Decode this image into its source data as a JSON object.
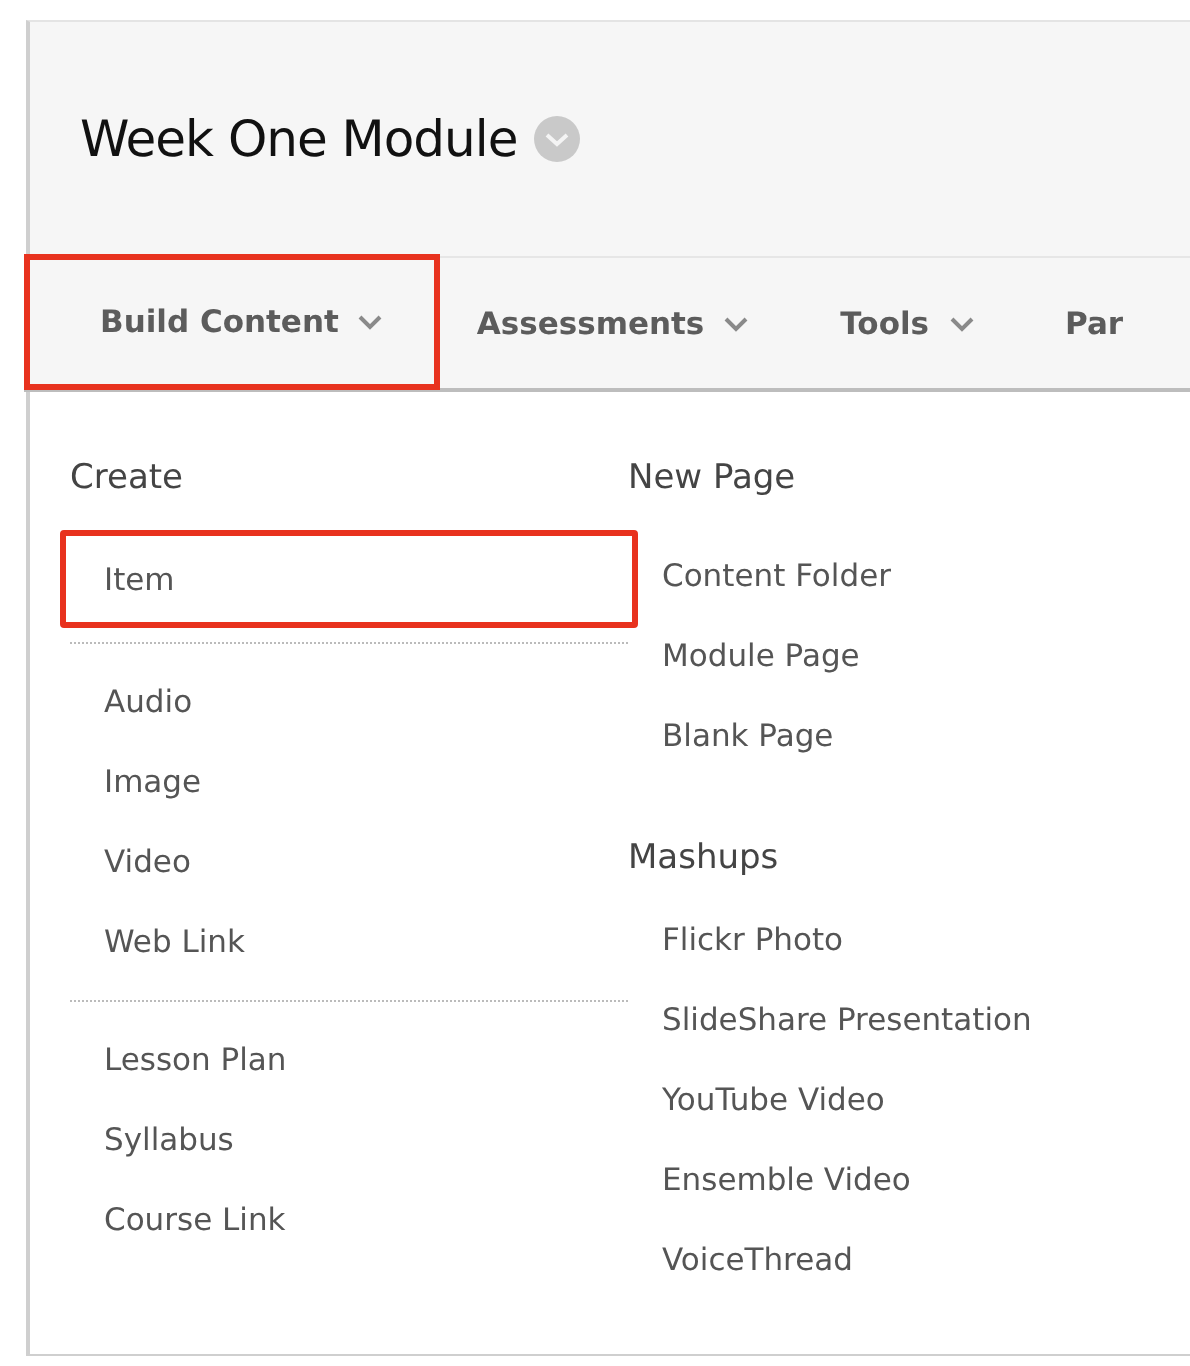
{
  "page": {
    "title": "Week One Module"
  },
  "menu_bar": {
    "tabs": [
      {
        "label": "Build Content",
        "highlighted": true,
        "caret": true
      },
      {
        "label": "Assessments",
        "highlighted": false,
        "caret": true
      },
      {
        "label": "Tools",
        "highlighted": false,
        "caret": true
      },
      {
        "label": "Par",
        "highlighted": false,
        "caret": false
      }
    ]
  },
  "dropdown": {
    "columns": [
      {
        "sections": [
          {
            "heading": "Create",
            "groups": [
              {
                "items": [
                  {
                    "label": "Item",
                    "highlighted": true
                  }
                ]
              },
              {
                "items": [
                  {
                    "label": "Audio",
                    "highlighted": false
                  },
                  {
                    "label": "Image",
                    "highlighted": false
                  },
                  {
                    "label": "Video",
                    "highlighted": false
                  },
                  {
                    "label": "Web Link",
                    "highlighted": false
                  }
                ]
              },
              {
                "items": [
                  {
                    "label": "Lesson Plan",
                    "highlighted": false
                  },
                  {
                    "label": "Syllabus",
                    "highlighted": false
                  },
                  {
                    "label": "Course Link",
                    "highlighted": false
                  }
                ]
              }
            ]
          }
        ]
      },
      {
        "sections": [
          {
            "heading": "New Page",
            "groups": [
              {
                "items": [
                  {
                    "label": "Content Folder",
                    "highlighted": false
                  },
                  {
                    "label": "Module Page",
                    "highlighted": false
                  },
                  {
                    "label": "Blank Page",
                    "highlighted": false
                  }
                ]
              }
            ]
          },
          {
            "heading": "Mashups",
            "groups": [
              {
                "items": [
                  {
                    "label": "Flickr Photo",
                    "highlighted": false
                  },
                  {
                    "label": "SlideShare Presentation",
                    "highlighted": false
                  },
                  {
                    "label": "YouTube Video",
                    "highlighted": false
                  },
                  {
                    "label": "Ensemble Video",
                    "highlighted": false
                  },
                  {
                    "label": "VoiceThread",
                    "highlighted": false
                  }
                ]
              }
            ]
          }
        ]
      }
    ]
  }
}
